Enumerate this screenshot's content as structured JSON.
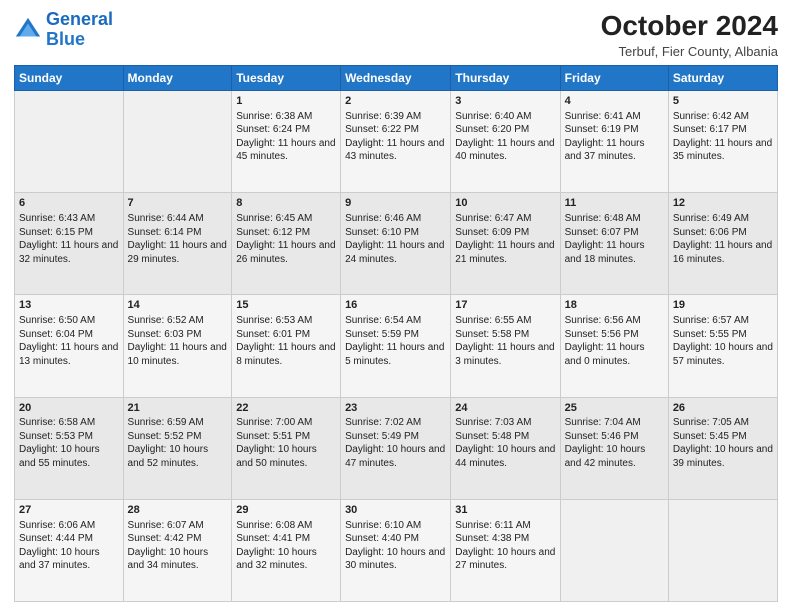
{
  "header": {
    "logo_line1": "General",
    "logo_line2": "Blue",
    "month": "October 2024",
    "location": "Terbuf, Fier County, Albania"
  },
  "days_of_week": [
    "Sunday",
    "Monday",
    "Tuesday",
    "Wednesday",
    "Thursday",
    "Friday",
    "Saturday"
  ],
  "weeks": [
    [
      {
        "day": "",
        "info": ""
      },
      {
        "day": "",
        "info": ""
      },
      {
        "day": "1",
        "info": "Sunrise: 6:38 AM\nSunset: 6:24 PM\nDaylight: 11 hours and 45 minutes."
      },
      {
        "day": "2",
        "info": "Sunrise: 6:39 AM\nSunset: 6:22 PM\nDaylight: 11 hours and 43 minutes."
      },
      {
        "day": "3",
        "info": "Sunrise: 6:40 AM\nSunset: 6:20 PM\nDaylight: 11 hours and 40 minutes."
      },
      {
        "day": "4",
        "info": "Sunrise: 6:41 AM\nSunset: 6:19 PM\nDaylight: 11 hours and 37 minutes."
      },
      {
        "day": "5",
        "info": "Sunrise: 6:42 AM\nSunset: 6:17 PM\nDaylight: 11 hours and 35 minutes."
      }
    ],
    [
      {
        "day": "6",
        "info": "Sunrise: 6:43 AM\nSunset: 6:15 PM\nDaylight: 11 hours and 32 minutes."
      },
      {
        "day": "7",
        "info": "Sunrise: 6:44 AM\nSunset: 6:14 PM\nDaylight: 11 hours and 29 minutes."
      },
      {
        "day": "8",
        "info": "Sunrise: 6:45 AM\nSunset: 6:12 PM\nDaylight: 11 hours and 26 minutes."
      },
      {
        "day": "9",
        "info": "Sunrise: 6:46 AM\nSunset: 6:10 PM\nDaylight: 11 hours and 24 minutes."
      },
      {
        "day": "10",
        "info": "Sunrise: 6:47 AM\nSunset: 6:09 PM\nDaylight: 11 hours and 21 minutes."
      },
      {
        "day": "11",
        "info": "Sunrise: 6:48 AM\nSunset: 6:07 PM\nDaylight: 11 hours and 18 minutes."
      },
      {
        "day": "12",
        "info": "Sunrise: 6:49 AM\nSunset: 6:06 PM\nDaylight: 11 hours and 16 minutes."
      }
    ],
    [
      {
        "day": "13",
        "info": "Sunrise: 6:50 AM\nSunset: 6:04 PM\nDaylight: 11 hours and 13 minutes."
      },
      {
        "day": "14",
        "info": "Sunrise: 6:52 AM\nSunset: 6:03 PM\nDaylight: 11 hours and 10 minutes."
      },
      {
        "day": "15",
        "info": "Sunrise: 6:53 AM\nSunset: 6:01 PM\nDaylight: 11 hours and 8 minutes."
      },
      {
        "day": "16",
        "info": "Sunrise: 6:54 AM\nSunset: 5:59 PM\nDaylight: 11 hours and 5 minutes."
      },
      {
        "day": "17",
        "info": "Sunrise: 6:55 AM\nSunset: 5:58 PM\nDaylight: 11 hours and 3 minutes."
      },
      {
        "day": "18",
        "info": "Sunrise: 6:56 AM\nSunset: 5:56 PM\nDaylight: 11 hours and 0 minutes."
      },
      {
        "day": "19",
        "info": "Sunrise: 6:57 AM\nSunset: 5:55 PM\nDaylight: 10 hours and 57 minutes."
      }
    ],
    [
      {
        "day": "20",
        "info": "Sunrise: 6:58 AM\nSunset: 5:53 PM\nDaylight: 10 hours and 55 minutes."
      },
      {
        "day": "21",
        "info": "Sunrise: 6:59 AM\nSunset: 5:52 PM\nDaylight: 10 hours and 52 minutes."
      },
      {
        "day": "22",
        "info": "Sunrise: 7:00 AM\nSunset: 5:51 PM\nDaylight: 10 hours and 50 minutes."
      },
      {
        "day": "23",
        "info": "Sunrise: 7:02 AM\nSunset: 5:49 PM\nDaylight: 10 hours and 47 minutes."
      },
      {
        "day": "24",
        "info": "Sunrise: 7:03 AM\nSunset: 5:48 PM\nDaylight: 10 hours and 44 minutes."
      },
      {
        "day": "25",
        "info": "Sunrise: 7:04 AM\nSunset: 5:46 PM\nDaylight: 10 hours and 42 minutes."
      },
      {
        "day": "26",
        "info": "Sunrise: 7:05 AM\nSunset: 5:45 PM\nDaylight: 10 hours and 39 minutes."
      }
    ],
    [
      {
        "day": "27",
        "info": "Sunrise: 6:06 AM\nSunset: 4:44 PM\nDaylight: 10 hours and 37 minutes."
      },
      {
        "day": "28",
        "info": "Sunrise: 6:07 AM\nSunset: 4:42 PM\nDaylight: 10 hours and 34 minutes."
      },
      {
        "day": "29",
        "info": "Sunrise: 6:08 AM\nSunset: 4:41 PM\nDaylight: 10 hours and 32 minutes."
      },
      {
        "day": "30",
        "info": "Sunrise: 6:10 AM\nSunset: 4:40 PM\nDaylight: 10 hours and 30 minutes."
      },
      {
        "day": "31",
        "info": "Sunrise: 6:11 AM\nSunset: 4:38 PM\nDaylight: 10 hours and 27 minutes."
      },
      {
        "day": "",
        "info": ""
      },
      {
        "day": "",
        "info": ""
      }
    ]
  ]
}
